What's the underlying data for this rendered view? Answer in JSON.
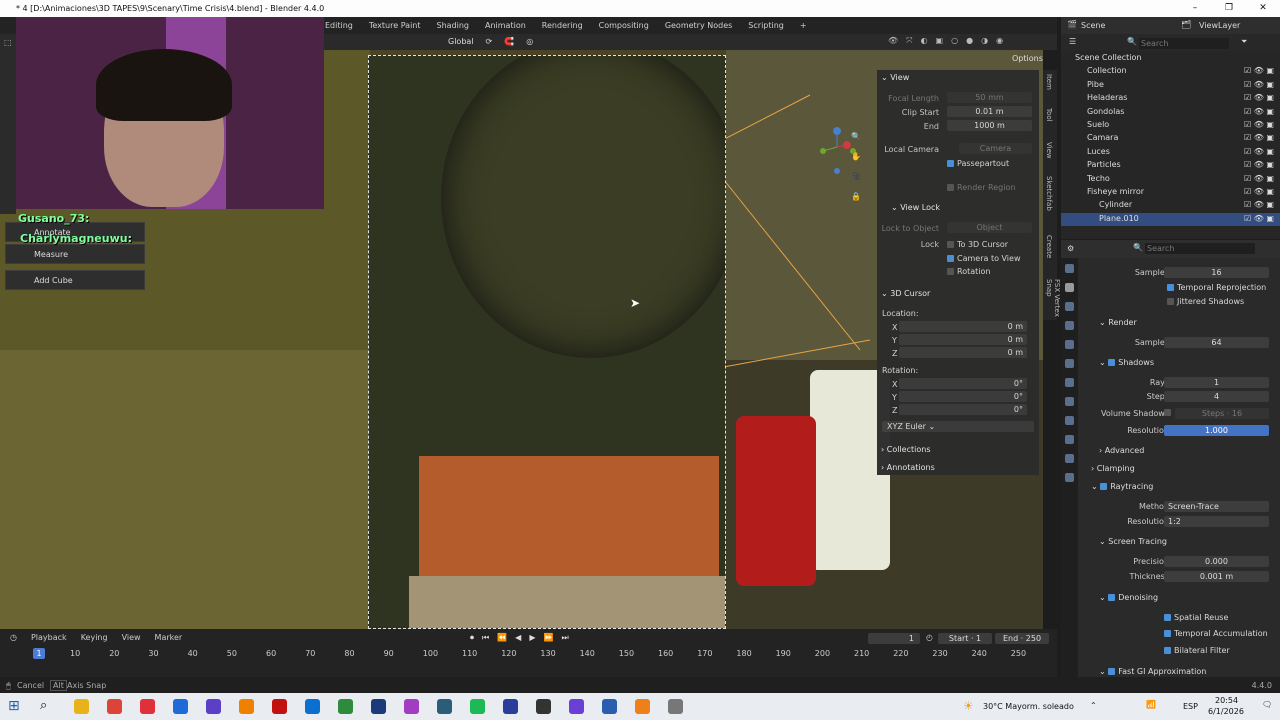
{
  "window": {
    "title": "* 4 [D:\\Animaciones\\3D TAPES\\9\\Scenary\\Time Crisis\\4.blend] - Blender 4.4.0",
    "minimize": "–",
    "maximize": "❐",
    "close": "✕"
  },
  "menu": [
    "Editing",
    "Texture Paint",
    "Shading",
    "Animation",
    "Rendering",
    "Compositing",
    "Geometry Nodes",
    "Scripting",
    "+"
  ],
  "viewport_header": {
    "orientation": "Global",
    "options": "Options"
  },
  "chat": {
    "user1": "Gusano_73:",
    "user2": "Charlymagneuwu:"
  },
  "tools": {
    "annotate": "Annotate",
    "measure": "Measure",
    "add_cube": "Add Cube"
  },
  "npanel": {
    "view_title": "View",
    "focal_length_label": "Focal Length",
    "focal_length": "50 mm",
    "clip_start_label": "Clip Start",
    "clip_start": "0.01 m",
    "end_label": "End",
    "end": "1000 m",
    "local_camera_label": "Local Camera",
    "local_camera": "Camera",
    "passepartout": "Passepartout",
    "render_region": "Render Region",
    "view_lock_title": "View Lock",
    "lock_to_object_label": "Lock to Object",
    "lock_to_object": "Object",
    "lock_label": "Lock",
    "to_3d_cursor": "To 3D Cursor",
    "camera_to_view": "Camera to View",
    "rotation_lock": "Rotation",
    "cursor_title": "3D Cursor",
    "location_label": "Location:",
    "x_label": "X",
    "y_label": "Y",
    "z_label": "Z",
    "loc_x": "0 m",
    "loc_y": "0 m",
    "loc_z": "0 m",
    "rotation_label": "Rotation:",
    "rot_x": "0°",
    "rot_y": "0°",
    "rot_z": "0°",
    "rot_mode": "XYZ Euler",
    "collections": "Collections",
    "annotations": "Annotations"
  },
  "ntabs": [
    "Item",
    "Tool",
    "View",
    "Sketchfab",
    "Create",
    "FSX Vertex Snap"
  ],
  "timeline": {
    "playback": "Playback",
    "keying": "Keying",
    "view": "View",
    "marker": "Marker",
    "current_frame": "1",
    "start_label": "Start",
    "start": "1",
    "end_label": "End",
    "end": "250",
    "ticks": [
      "10",
      "20",
      "30",
      "40",
      "50",
      "60",
      "70",
      "80",
      "90",
      "100",
      "110",
      "120",
      "130",
      "140",
      "150",
      "160",
      "170",
      "180",
      "190",
      "200",
      "210",
      "220",
      "230",
      "240",
      "250"
    ],
    "cursor": "1"
  },
  "statusbar": {
    "cancel": "Cancel",
    "alt": "Alt",
    "axis_snap": "Axis Snap",
    "version": "4.4.0"
  },
  "outliner_header": {
    "scene": "Scene",
    "view_layer": "ViewLayer",
    "search_placeholder": "Search"
  },
  "outliner": [
    {
      "name": "Scene Collection",
      "indent": 0
    },
    {
      "name": "Collection",
      "indent": 1
    },
    {
      "name": "Pibe",
      "indent": 1
    },
    {
      "name": "Heladeras",
      "indent": 1
    },
    {
      "name": "Gondolas",
      "indent": 1
    },
    {
      "name": "Suelo",
      "indent": 1
    },
    {
      "name": "Camara",
      "indent": 1
    },
    {
      "name": "Luces",
      "indent": 1
    },
    {
      "name": "Particles",
      "indent": 1
    },
    {
      "name": "Techo",
      "indent": 1
    },
    {
      "name": "Fisheye mirror",
      "indent": 1
    },
    {
      "name": "Cylinder",
      "indent": 2
    },
    {
      "name": "Plane.010",
      "indent": 2
    }
  ],
  "props": {
    "search_placeholder": "Search",
    "samples_label": "Samples",
    "samples_viewport": "16",
    "temporal_reprojection": "Temporal Reprojection",
    "jittered_shadows": "Jittered Shadows",
    "render_title": "Render",
    "render_samples": "64",
    "shadows_title": "Shadows",
    "rays_label": "Rays",
    "rays": "1",
    "steps_label": "Steps",
    "steps": "4",
    "volume_shadows_label": "Volume Shadows",
    "vol_steps_label": "Steps",
    "vol_steps": "16",
    "resolution_label": "Resolution",
    "resolution": "1.000",
    "advanced_title": "Advanced",
    "clamping_title": "Clamping",
    "raytracing_title": "Raytracing",
    "method_label": "Method",
    "method": "Screen-Trace",
    "rt_resolution": "1:2",
    "screen_tracing_title": "Screen Tracing",
    "precision_label": "Precision",
    "precision": "0.000",
    "thickness_label": "Thickness",
    "thickness": "0.001 m",
    "denoising_title": "Denoising",
    "spatial_reuse": "Spatial Reuse",
    "temporal_accumulation": "Temporal Accumulation",
    "bilateral_filter": "Bilateral Filter",
    "fast_gi_title": "Fast GI Approximation"
  },
  "taskbar": {
    "weather": "30°C Mayorm. soleado",
    "lang": "ESP",
    "time": "20:54",
    "date": "6/1/2026"
  }
}
